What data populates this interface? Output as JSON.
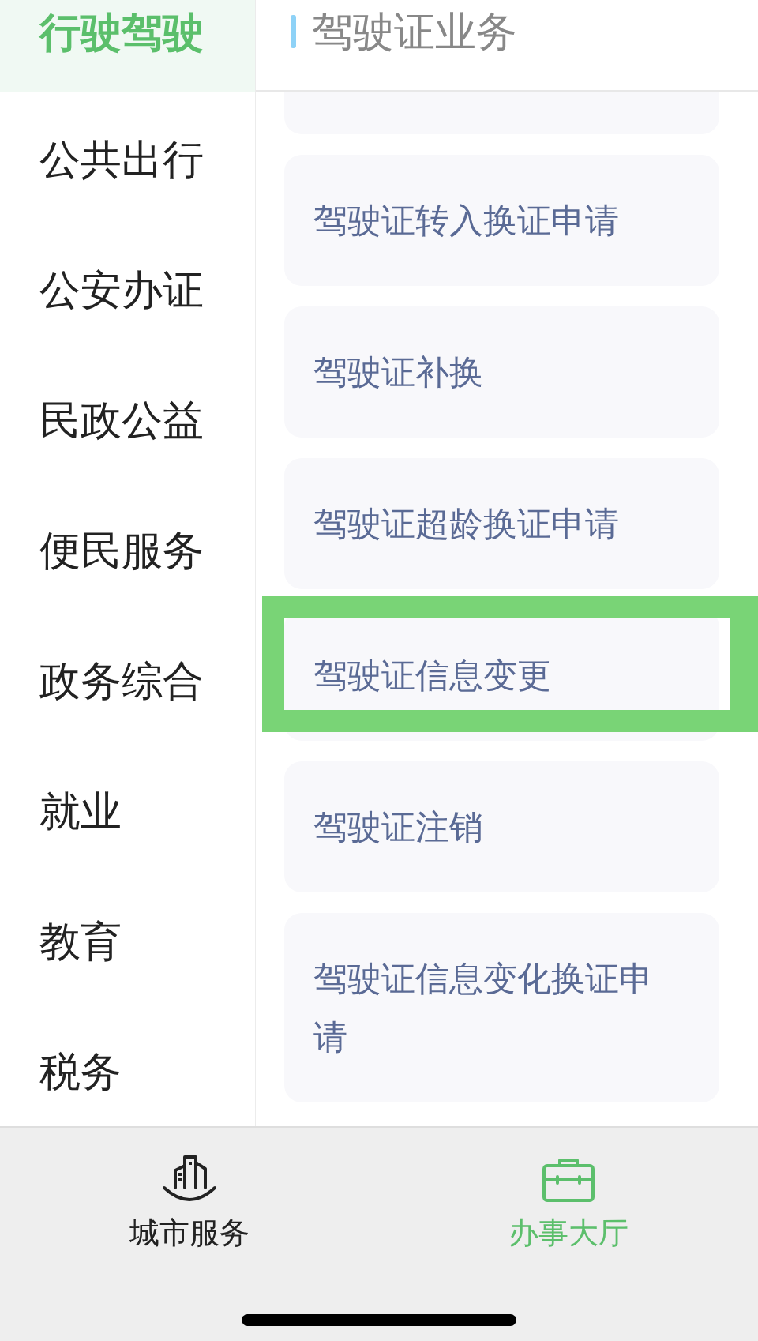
{
  "sidebar": {
    "items": [
      {
        "label": "行驶驾驶",
        "selected": true
      },
      {
        "label": "公共出行",
        "selected": false
      },
      {
        "label": "公安办证",
        "selected": false
      },
      {
        "label": "民政公益",
        "selected": false
      },
      {
        "label": "便民服务",
        "selected": false
      },
      {
        "label": "政务综合",
        "selected": false
      },
      {
        "label": "就业",
        "selected": false
      },
      {
        "label": "教育",
        "selected": false
      },
      {
        "label": "税务",
        "selected": false
      }
    ]
  },
  "section": {
    "title": "驾驶证业务"
  },
  "services": [
    {
      "highlighted": false
    },
    {
      "label": "驾驶证转入换证申请",
      "highlighted": false
    },
    {
      "label": "驾驶证补换",
      "highlighted": false
    },
    {
      "label": "驾驶证超龄换证申请",
      "highlighted": false
    },
    {
      "label": "驾驶证信息变更",
      "highlighted": true
    },
    {
      "label": "驾驶证注销",
      "highlighted": false
    },
    {
      "label": "驾驶证信息变化换证申请",
      "highlighted": false
    }
  ],
  "tab_bar": {
    "tabs": [
      {
        "kind": "city",
        "label": "城市服务",
        "selected": false
      },
      {
        "kind": "hall",
        "label": "办事大厅",
        "selected": true
      }
    ]
  }
}
